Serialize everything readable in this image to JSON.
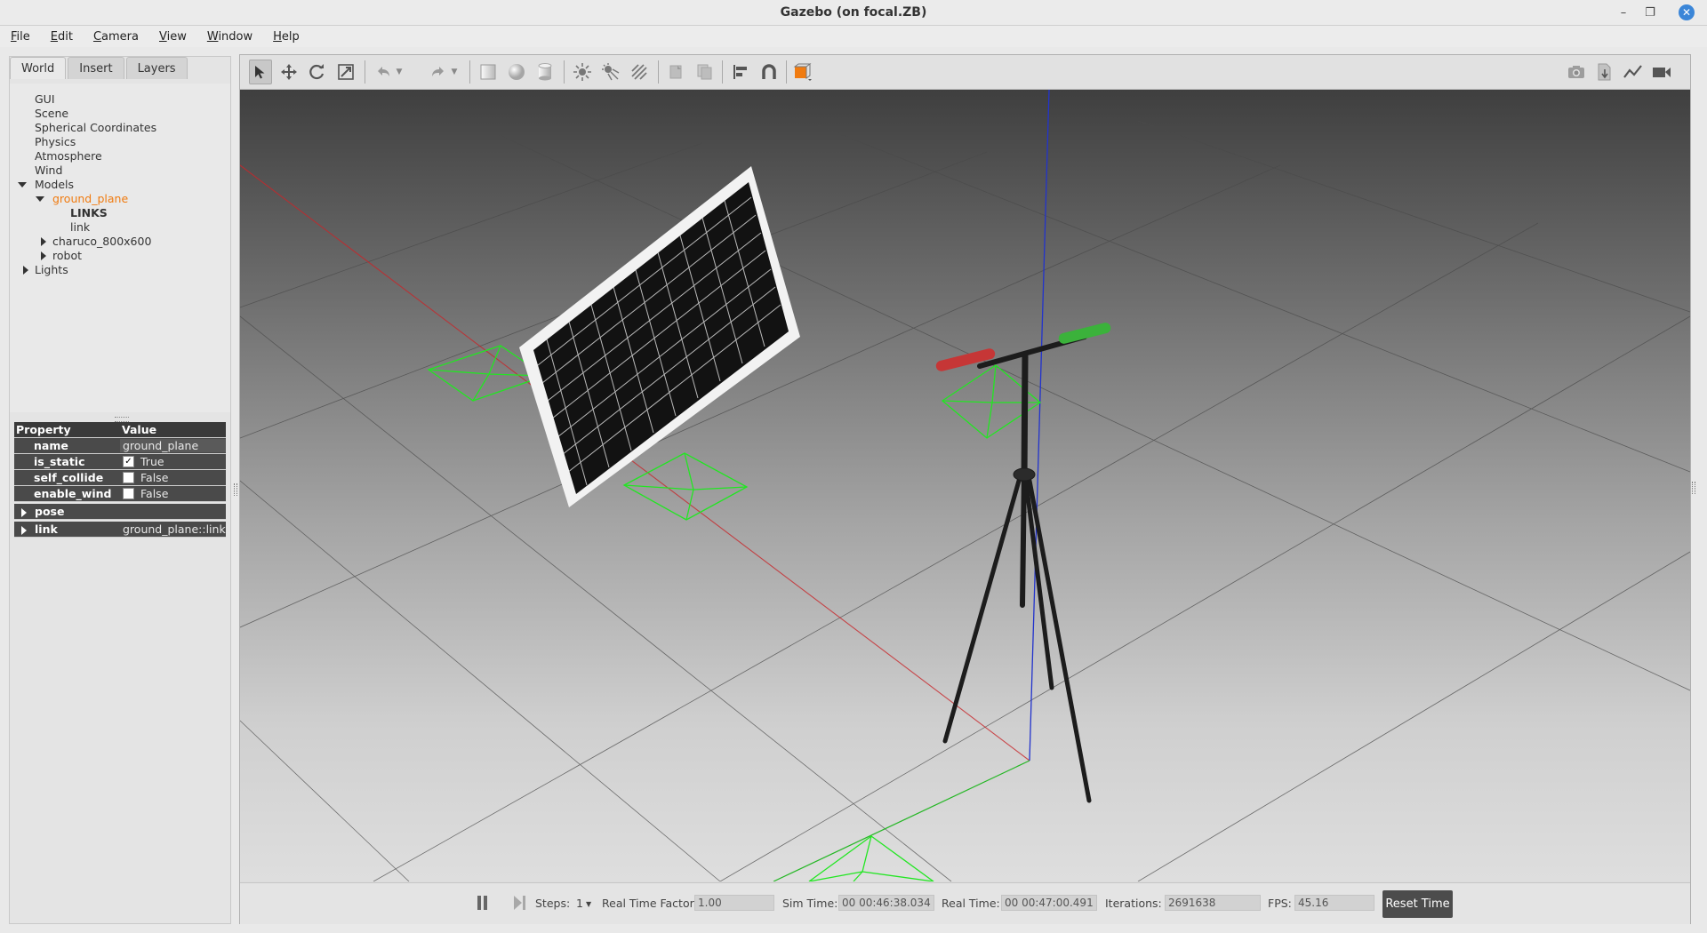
{
  "window": {
    "title": "Gazebo (on focal.ZB)",
    "minimize_glyph": "–",
    "maximize_glyph": "❐",
    "close_glyph": "✕"
  },
  "menu": [
    "File",
    "Edit",
    "Camera",
    "View",
    "Window",
    "Help"
  ],
  "left_panel": {
    "tabs": [
      "World",
      "Insert",
      "Layers"
    ],
    "tree": {
      "gui": "GUI",
      "scene": "Scene",
      "spherical": "Spherical Coordinates",
      "physics": "Physics",
      "atmosphere": "Atmosphere",
      "wind": "Wind",
      "models": "Models",
      "ground_plane": "ground_plane",
      "links_header": "LINKS",
      "link": "link",
      "charuco": "charuco_800x600",
      "robot": "robot",
      "lights": "Lights"
    },
    "properties": {
      "header_property": "Property",
      "header_value": "Value",
      "rows": [
        {
          "key": "name",
          "value": "ground_plane"
        },
        {
          "key": "is_static",
          "value": "True",
          "checked": "✓"
        },
        {
          "key": "self_collide",
          "value": "False"
        },
        {
          "key": "enable_wind",
          "value": "False"
        },
        {
          "key": "pose",
          "value": ""
        },
        {
          "key": "link",
          "value": "ground_plane::link"
        }
      ]
    }
  },
  "toolbar": {
    "icons": [
      "select-mode-icon",
      "translate-mode-icon",
      "rotate-mode-icon",
      "scale-mode-icon",
      "undo-icon",
      "undo-dropdown-icon",
      "redo-icon",
      "redo-dropdown-icon",
      "box-shape-icon",
      "sphere-shape-icon",
      "cylinder-shape-icon",
      "point-light-icon",
      "spot-light-icon",
      "directional-light-icon",
      "copy-icon",
      "paste-icon",
      "align-icon",
      "snap-icon",
      "view-angle-icon",
      "screenshot-icon",
      "log-icon",
      "plot-icon",
      "video-record-icon"
    ]
  },
  "bottom": {
    "steps_label": "Steps:",
    "steps_value": "1",
    "rtf_label": "Real Time Factor:",
    "rtf_value": "1.00",
    "sim_time_label": "Sim Time:",
    "sim_time_value": "00 00:46:38.034",
    "real_time_label": "Real Time:",
    "real_time_value": "00 00:47:00.491",
    "iterations_label": "Iterations:",
    "iterations_value": "2691638",
    "fps_label": "FPS:",
    "fps_value": "45.16",
    "reset_label": "Reset Time"
  },
  "colors": {
    "selected_tree_item": "#f07b10",
    "frustum_green": "#22dd22",
    "axis_red": "#cc2222",
    "axis_blue": "#2222cc",
    "axis_green": "#22bb22"
  }
}
